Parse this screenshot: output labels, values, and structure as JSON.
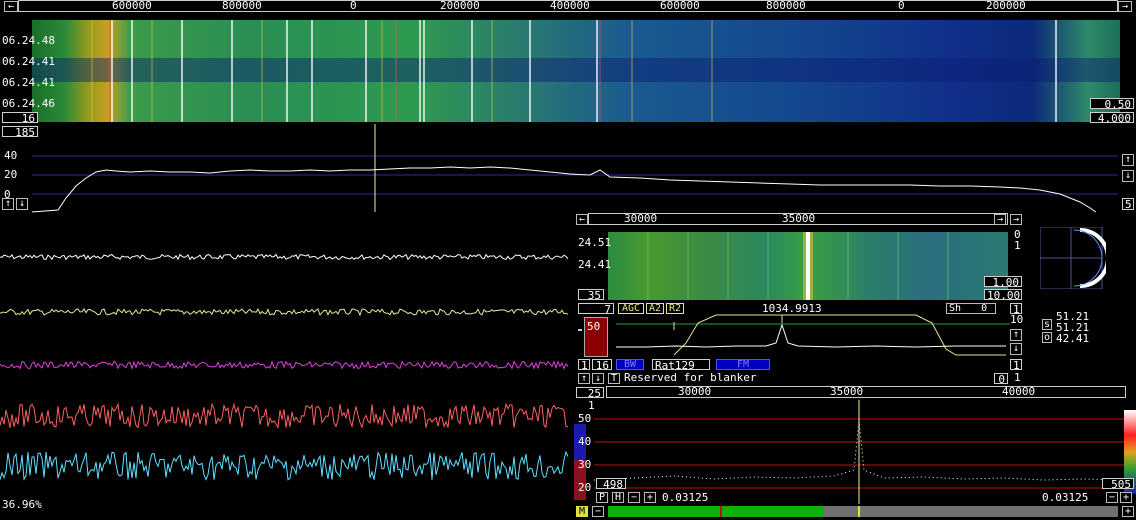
{
  "main_waterfall": {
    "freq_ticks": [
      "600000",
      "800000",
      "0",
      "200000",
      "400000",
      "600000",
      "800000",
      "0",
      "200000"
    ],
    "time_labels": [
      "06.24.48",
      "06.24.41",
      "06.24.41",
      "06.24.46"
    ],
    "avg_box": "16",
    "gain_box": "0.50",
    "contrast_box": "4.000"
  },
  "main_spectrum": {
    "top_box": "185",
    "y_ticks": [
      "40",
      "20",
      "0"
    ],
    "right_box": "5"
  },
  "channels": {
    "colors": [
      "#ffffff",
      "#e8e890",
      "#e040e0",
      "#ff6060",
      "#60e0ff"
    ],
    "cpu_text": "36.96%"
  },
  "hires_waterfall": {
    "freq_ticks": [
      "30000",
      "35000"
    ],
    "time_labels": [
      "24.51",
      "24.41"
    ],
    "right_top": [
      "0",
      "1"
    ],
    "avg_box": "35",
    "gain_box": "1.00",
    "contrast_box": "10.00"
  },
  "hires_controls": {
    "left_box": "7",
    "agc": "AGC",
    "a2": "A2",
    "r2": "R2",
    "freq_readout": "1034.9913",
    "sh_label": "Sh",
    "sh_value": "0",
    "right_box": "1",
    "scale_right": "10",
    "s_meter_value": "50",
    "row_box1": "1",
    "row_box2": "16",
    "rat_label": "Rat129",
    "row_right_box": "1",
    "t_label": "T",
    "blanker_text": "Reserved for blanker",
    "blanker_box": "0",
    "blanker_right": "1"
  },
  "polar": {
    "s_label": "s",
    "o_label": "o",
    "values": [
      "51.21",
      "51.21",
      "42.41"
    ]
  },
  "baseband": {
    "left_box": "25",
    "freq_ticks": [
      "30000",
      "35000",
      "40000"
    ],
    "y_ticks": [
      "50",
      "40",
      "30",
      "20"
    ],
    "top_marker": "1",
    "left_num": "498",
    "right_num": "505",
    "p_label": "P",
    "h_label": "H",
    "left_value": "0.03125",
    "right_value": "0.03125",
    "m_label": "M"
  }
}
